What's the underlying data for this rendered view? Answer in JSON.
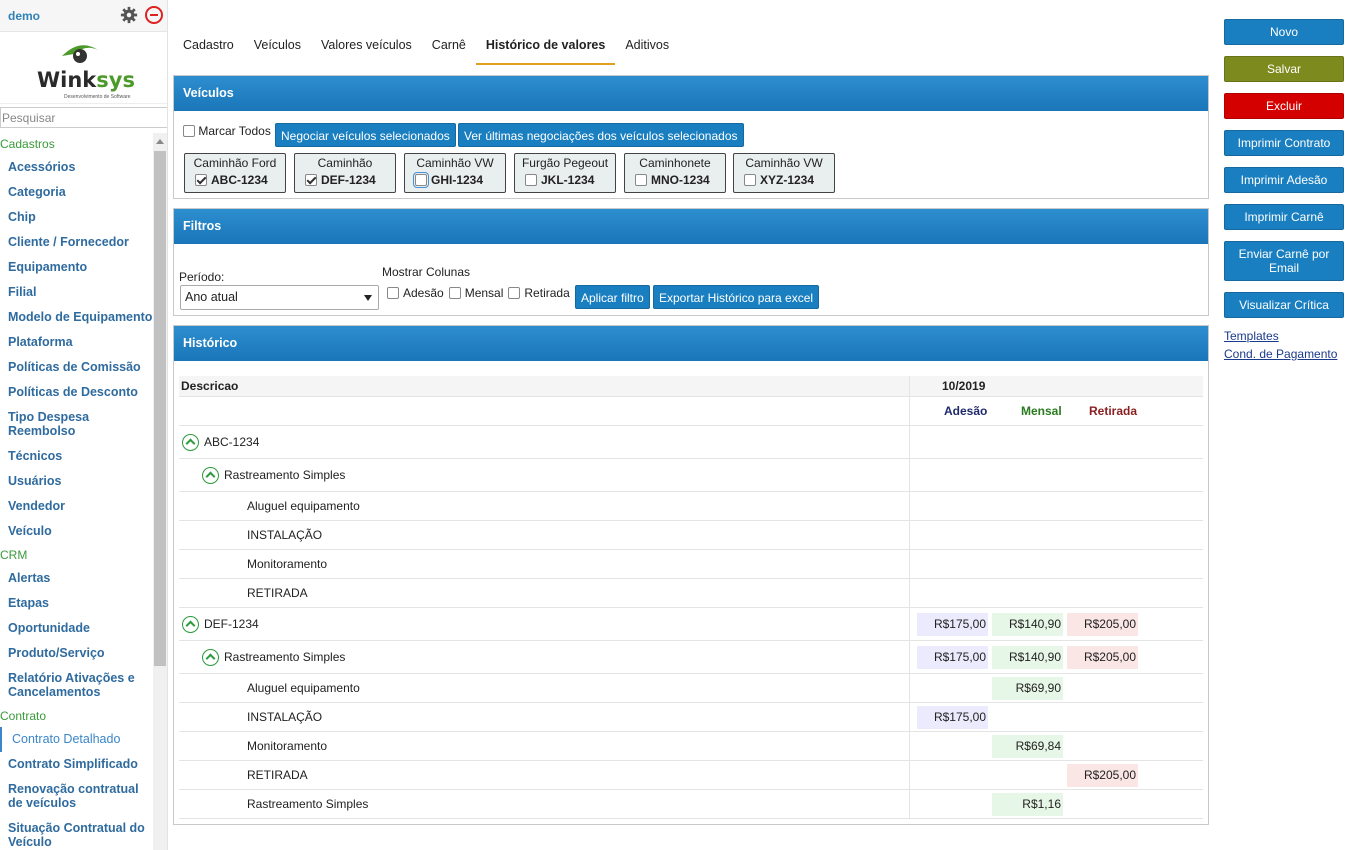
{
  "sidebar": {
    "user": "demo",
    "logo": {
      "part1": "Wink",
      "part2": "sys",
      "subtitle": "Desenvolvimento de Software"
    },
    "search_placeholder": "Pesquisar",
    "groups": [
      {
        "title": "Cadastros",
        "items": [
          "Acessórios",
          "Categoria",
          "Chip",
          "Cliente / Fornecedor",
          "Equipamento",
          "Filial",
          "Modelo de Equipamento",
          "Plataforma",
          "Políticas de Comissão",
          "Políticas de Desconto",
          "Tipo Despesa Reembolso",
          "Técnicos",
          "Usuários",
          "Vendedor",
          "Veículo"
        ]
      },
      {
        "title": "CRM",
        "items": [
          "Alertas",
          "Etapas",
          "Oportunidade",
          "Produto/Serviço",
          "Relatório Ativações e Cancelamentos"
        ]
      },
      {
        "title": "Contrato",
        "items": [
          "Contrato Detalhado",
          "Contrato Simplificado",
          "Renovação contratual de veículos",
          "Situação Contratual do Veículo"
        ]
      }
    ],
    "active_item": "Contrato Detalhado"
  },
  "tabs": [
    "Cadastro",
    "Veículos",
    "Valores veículos",
    "Carnê",
    "Histórico de valores",
    "Aditivos"
  ],
  "active_tab": "Histórico de valores",
  "veiculos": {
    "title": "Veículos",
    "marcar_todos": "Marcar Todos",
    "btn_negociar": "Negociar veículos selecionados",
    "btn_ultimas": "Ver últimas negociações dos veículos selecionados",
    "vehicles": [
      {
        "name": "Caminhão Ford",
        "plate": "ABC-1234",
        "checked": true
      },
      {
        "name": "Caminhão",
        "plate": "DEF-1234",
        "checked": true
      },
      {
        "name": "Caminhão VW",
        "plate": "GHI-1234",
        "checked": false
      },
      {
        "name": "Furgão Pegeout",
        "plate": "JKL-1234",
        "checked": false
      },
      {
        "name": "Caminhonete",
        "plate": "MNO-1234",
        "checked": false
      },
      {
        "name": "Caminhão VW",
        "plate": "XYZ-1234",
        "checked": false
      }
    ]
  },
  "filtros": {
    "title": "Filtros",
    "periodo_label": "Período:",
    "periodo_value": "Ano atual",
    "colunas_label": "Mostrar Colunas",
    "colunas": [
      "Adesão",
      "Mensal",
      "Retirada"
    ],
    "btn_aplicar": "Aplicar filtro",
    "btn_exportar": "Exportar Histórico para excel"
  },
  "historico": {
    "title": "Histórico",
    "col_desc": "Descricao",
    "period": "10/2019",
    "col_adesao": "Adesão",
    "col_mensal": "Mensal",
    "col_retirada": "Retirada",
    "colors": {
      "adesao": "#1f2a6b",
      "mensal": "#2a7a1f",
      "retirada": "#8a1f1f"
    },
    "rows": [
      {
        "level": 0,
        "label": "ABC-1234",
        "toggle": true,
        "ad": "",
        "me": "",
        "re": ""
      },
      {
        "level": 1,
        "label": "Rastreamento Simples",
        "toggle": true,
        "ad": "",
        "me": "",
        "re": ""
      },
      {
        "level": 2,
        "label": "Aluguel equipamento",
        "toggle": false,
        "ad": "",
        "me": "",
        "re": ""
      },
      {
        "level": 2,
        "label": "INSTALAÇÃO",
        "toggle": false,
        "ad": "",
        "me": "",
        "re": ""
      },
      {
        "level": 2,
        "label": "Monitoramento",
        "toggle": false,
        "ad": "",
        "me": "",
        "re": ""
      },
      {
        "level": 2,
        "label": "RETIRADA",
        "toggle": false,
        "ad": "",
        "me": "",
        "re": ""
      },
      {
        "level": 0,
        "label": "DEF-1234",
        "toggle": true,
        "ad": "R$175,00",
        "me": "R$140,90",
        "re": "R$205,00"
      },
      {
        "level": 1,
        "label": "Rastreamento Simples",
        "toggle": true,
        "ad": "R$175,00",
        "me": "R$140,90",
        "re": "R$205,00"
      },
      {
        "level": 2,
        "label": "Aluguel equipamento",
        "toggle": false,
        "ad": "",
        "me": "R$69,90",
        "re": ""
      },
      {
        "level": 2,
        "label": "INSTALAÇÃO",
        "toggle": false,
        "ad": "R$175,00",
        "me": "",
        "re": ""
      },
      {
        "level": 2,
        "label": "Monitoramento",
        "toggle": false,
        "ad": "",
        "me": "R$69,84",
        "re": ""
      },
      {
        "level": 2,
        "label": "RETIRADA",
        "toggle": false,
        "ad": "",
        "me": "",
        "re": "R$205,00"
      },
      {
        "level": 2,
        "label": "Rastreamento Simples",
        "toggle": false,
        "ad": "",
        "me": "R$1,16",
        "re": ""
      }
    ]
  },
  "actions": {
    "buttons": [
      {
        "label": "Novo",
        "color": "blue"
      },
      {
        "label": "Salvar",
        "color": "olive"
      },
      {
        "label": "Excluir",
        "color": "red"
      },
      {
        "label": "Imprimir Contrato",
        "color": "blue"
      },
      {
        "label": "Imprimir Adesão",
        "color": "blue"
      },
      {
        "label": "Imprimir Carnê",
        "color": "blue"
      },
      {
        "label": "Enviar Carnê por Email",
        "color": "blue"
      },
      {
        "label": "Visualizar Crítica",
        "color": "blue"
      }
    ],
    "links": [
      "Templates",
      "Cond. de Pagamento"
    ]
  }
}
